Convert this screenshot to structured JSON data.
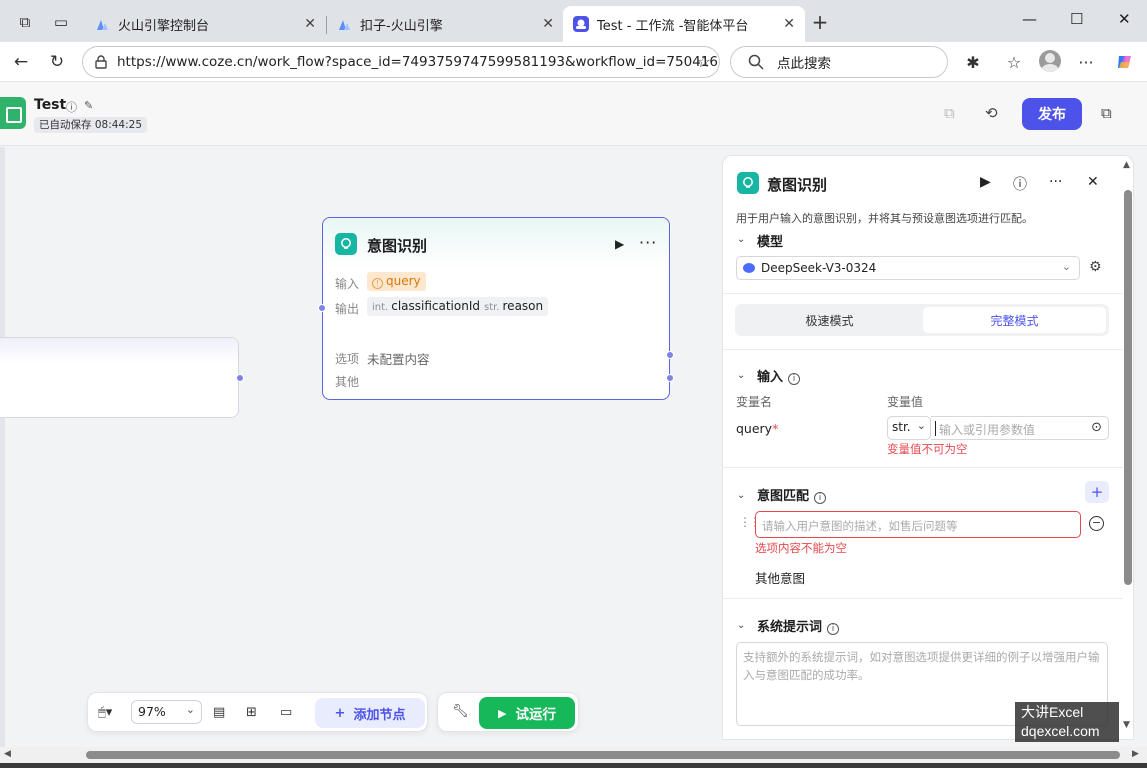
{
  "browser": {
    "tabs": [
      {
        "title": "火山引擎控制台"
      },
      {
        "title": "扣子-火山引擎"
      },
      {
        "title": "Test - 工作流 -智能体平台"
      }
    ],
    "url": "https://www.coze.cn/work_flow?space_id=7493759747599581193&workflow_id=7504162...",
    "search_placeholder": "点此搜索"
  },
  "app": {
    "title": "Test",
    "autosave": "已自动保存 08:44:25",
    "publish_label": "发布"
  },
  "canvas": {
    "node": {
      "title": "意图识别",
      "input_label": "输入",
      "input_var": "query",
      "output_label": "输出",
      "outputs": [
        {
          "type": "int.",
          "name": "classificationId"
        },
        {
          "type": "str.",
          "name": "reason"
        }
      ],
      "options_label": "选项",
      "options_value": "未配置内容",
      "other_label": "其他"
    },
    "toolbar": {
      "zoom": "97%",
      "add_node_label": "添加节点",
      "trial_run_label": "试运行"
    }
  },
  "panel": {
    "title": "意图识别",
    "description": "用于用户输入的意图识别，并将其与预设意图选项进行匹配。",
    "model_section": "模型",
    "model": "DeepSeek-V3-0324",
    "modes": [
      "极速模式",
      "完整模式"
    ],
    "active_mode": "完整模式",
    "input_section": "输入",
    "col_name": "变量名",
    "col_value": "变量值",
    "var_name": "query",
    "var_required": "*",
    "var_type": "str.",
    "var_value_placeholder": "输入或引用参数值",
    "var_error": "变量值不可为空",
    "intent_section": "意图匹配",
    "intent_placeholder": "请输入用户意图的描述，如售后问题等",
    "intent_error": "选项内容不能为空",
    "other_intent": "其他意图",
    "prompt_section": "系统提示词",
    "prompt_placeholder": "支持额外的系统提示词，如对意图选项提供更详细的例子以增强用户输入与意图匹配的成功率。"
  },
  "watermark": {
    "line1": "大讲Excel",
    "line2": "dqexcel.com"
  },
  "colors": {
    "accent": "#4d53e8",
    "node_icon": "#16b5a4",
    "run_green": "#17b85a",
    "error": "#e5484d"
  }
}
